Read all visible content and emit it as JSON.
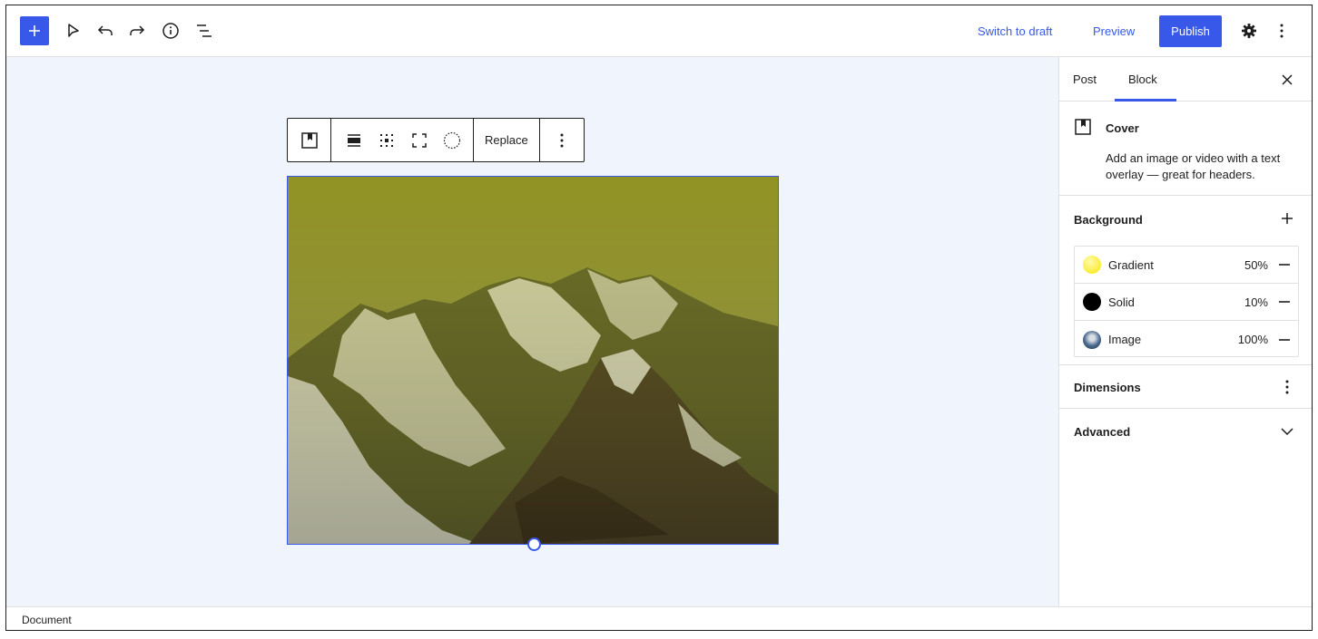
{
  "header": {
    "switch_to_draft": "Switch to draft",
    "preview": "Preview",
    "publish": "Publish",
    "accent_color": "#3858e9"
  },
  "toolbar": {
    "replace_label": "Replace"
  },
  "sidebar": {
    "tabs": [
      {
        "label": "Post",
        "active": false
      },
      {
        "label": "Block",
        "active": true
      }
    ],
    "block": {
      "name": "Cover",
      "description": "Add an image or video with a text overlay — great for headers."
    },
    "background": {
      "title": "Background",
      "layers": [
        {
          "label": "Gradient",
          "value": "50%",
          "swatch": "#fff66e"
        },
        {
          "label": "Solid",
          "value": "10%",
          "swatch": "#000000"
        },
        {
          "label": "Image",
          "value": "100%",
          "swatch": "#4a6a8e"
        }
      ]
    },
    "dimensions_title": "Dimensions",
    "advanced_title": "Advanced"
  },
  "footer": {
    "breadcrumb": "Document"
  }
}
